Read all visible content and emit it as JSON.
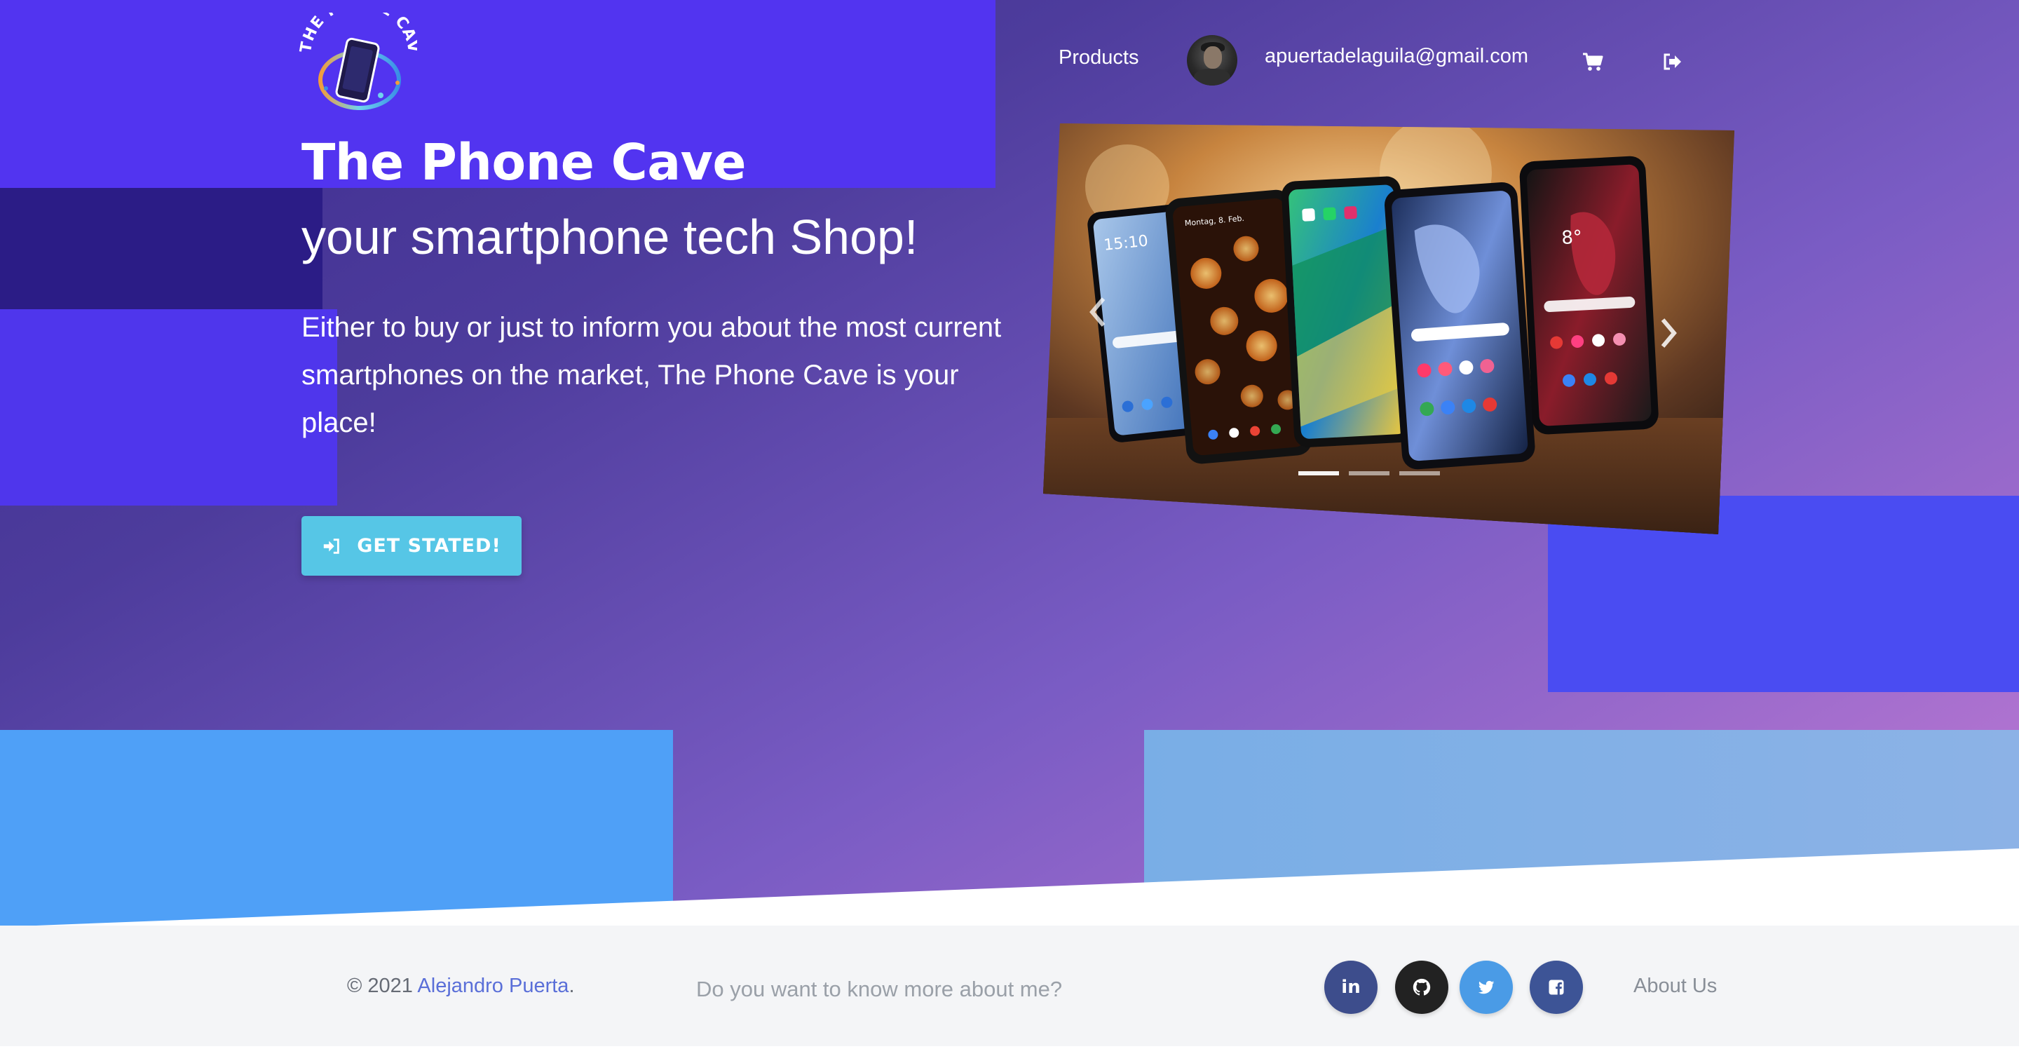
{
  "brand": {
    "logo_text": "THE PHONE CAVE"
  },
  "nav": {
    "products_label": "Products",
    "user_email": "apuertadelaguila@gmail.com",
    "cart_icon": "cart-icon",
    "logout_icon": "logout-icon"
  },
  "hero": {
    "title": "The Phone Cave",
    "subtitle": "your smartphone tech Shop!",
    "description": "Either to buy or just to inform you about the most current smartphones on the market, The Phone Cave is your place!",
    "cta_label": "GET STATED!",
    "cta_icon": "sign-in-icon"
  },
  "carousel": {
    "slide_count": 3,
    "active_slide": 1,
    "phone_screens": {
      "phone1_time": "15:10",
      "phone2_date": "Montag, 8. Feb.",
      "phone5_temp": "8°"
    }
  },
  "footer": {
    "copyright_prefix": "© 2021 ",
    "author_name": "Alejandro Puerta",
    "copyright_suffix": ".",
    "know_more": "Do you want to know more about me?",
    "social": {
      "linkedin": "in",
      "github_icon": "github-icon",
      "twitter_icon": "twitter-icon",
      "facebook_icon": "facebook-icon"
    },
    "about_us": "About Us"
  },
  "colors": {
    "hero_block_purple": "#5234f0",
    "hero_block_dark": "#2b1c86",
    "hero_block_blue": "#4fa0f7",
    "cta_cyan": "#56c6e6",
    "footer_bg": "#f4f5f7",
    "link_blue": "#5a6fd8"
  }
}
